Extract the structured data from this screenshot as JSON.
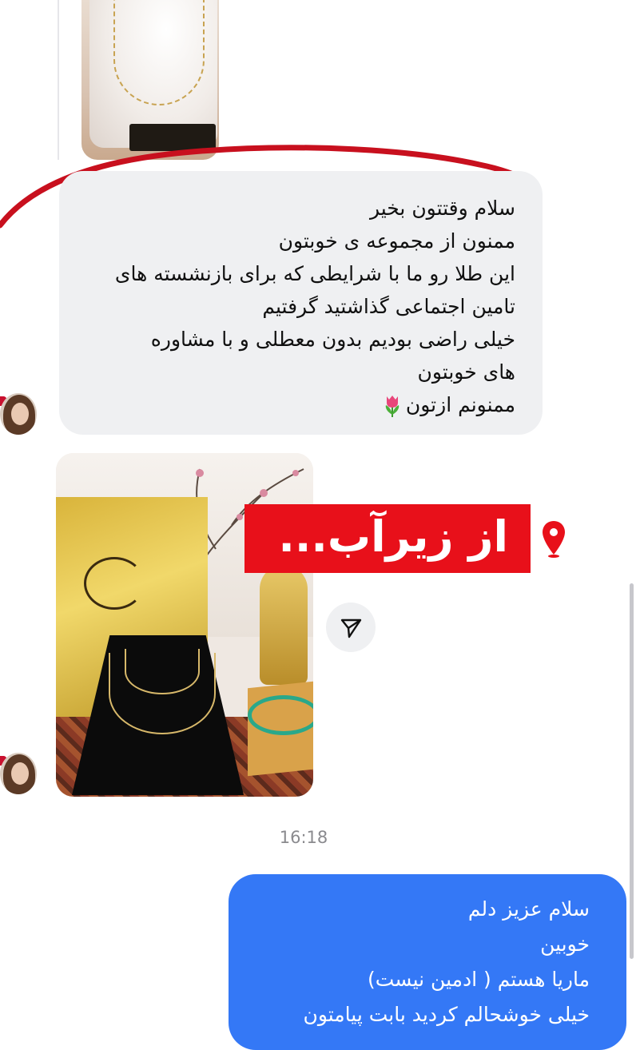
{
  "incoming_message": {
    "lines": [
      "سلام وقتتون بخیر",
      "ممنون از مجموعه ی خوبتون",
      "این طلا رو ما با شرایطی که برای بازنشسته های",
      "تامین اجتماعی گذاشتید گرفتیم",
      "خیلی راضی بودیم بدون معطلی و با مشاوره",
      "های خوبتون",
      "ممنونم ازتون"
    ],
    "emoji_icon": "tulip-icon"
  },
  "shared_post": {
    "overlay_text": "از زیرآب...",
    "overlay_color": "#e8101a",
    "pin_icon": "location-pin-icon"
  },
  "timestamp": "16:18",
  "outgoing_message": {
    "lines": [
      "سلام عزیز دلم",
      "خوبین",
      "ماریا هستم ( ادمین نیست)",
      "خیلی خوشحالم کردید بابت پیامتون"
    ]
  },
  "colors": {
    "incoming_bubble": "#eff0f2",
    "outgoing_bubble": "#3478f6",
    "annotation_red": "#c8101e"
  }
}
